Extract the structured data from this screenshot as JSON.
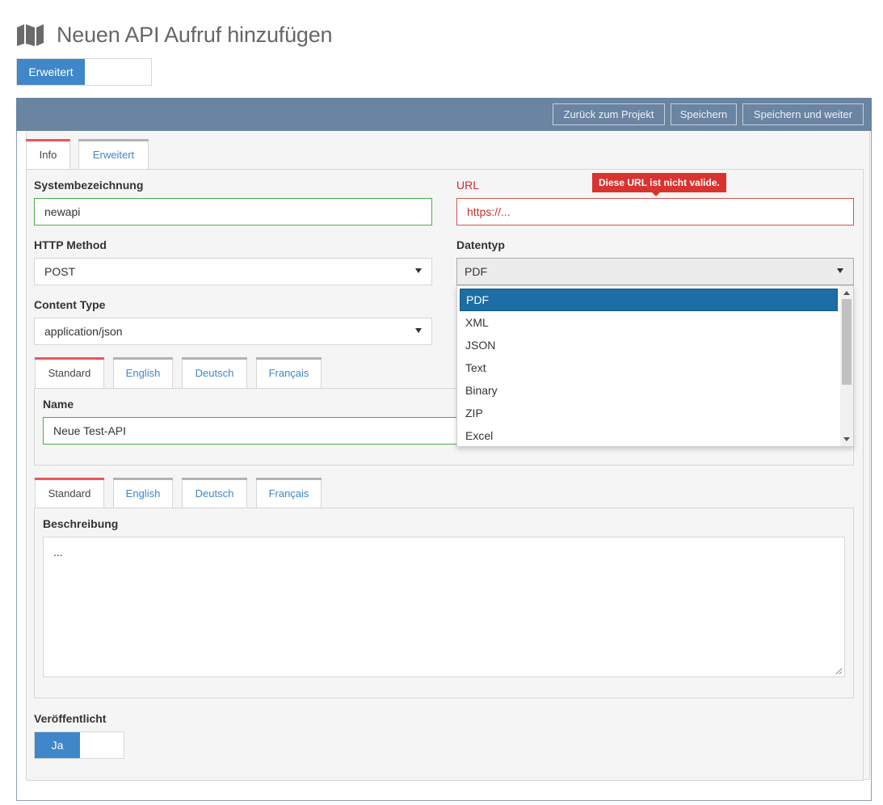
{
  "header": {
    "title": "Neuen API Aufruf hinzufügen",
    "icon": "map-icon"
  },
  "mode_toggle": {
    "active_label": "Erweitert"
  },
  "toolbar": {
    "back_label": "Zurück zum Projekt",
    "save_label": "Speichern",
    "save_continue_label": "Speichern und weiter"
  },
  "main_tabs": [
    {
      "label": "Info",
      "active": true
    },
    {
      "label": "Erweitert",
      "active": false
    }
  ],
  "form": {
    "system_name": {
      "label": "Systembezeichnung",
      "value": "newapi",
      "state": "valid"
    },
    "url": {
      "label": "URL",
      "value": "https://...",
      "state": "invalid",
      "error": "Diese URL ist nicht valide."
    },
    "http_method": {
      "label": "HTTP Method",
      "value": "POST"
    },
    "datentyp": {
      "label": "Datentyp",
      "value": "PDF",
      "open": true,
      "options": [
        "PDF",
        "XML",
        "JSON",
        "Text",
        "Binary",
        "ZIP",
        "Excel"
      ],
      "selected_index": 0
    },
    "content_type": {
      "label": "Content Type",
      "value": "application/json"
    },
    "name_tabs": [
      "Standard",
      "English",
      "Deutsch",
      "Français"
    ],
    "name": {
      "label": "Name",
      "value": "Neue Test-API"
    },
    "desc_tabs": [
      "Standard",
      "English",
      "Deutsch",
      "Français"
    ],
    "beschreibung": {
      "label": "Beschreibung",
      "value": "..."
    },
    "published": {
      "label": "Veröffentlicht",
      "toggle_label": "Ja",
      "value": true
    }
  },
  "colors": {
    "primary": "#3f87c9",
    "panel_header": "#6a84a2",
    "error": "#d9332f",
    "valid": "#4cae4c",
    "tab_active_marker": "#e9575c",
    "dropdown_selected": "#1c6ea4"
  }
}
